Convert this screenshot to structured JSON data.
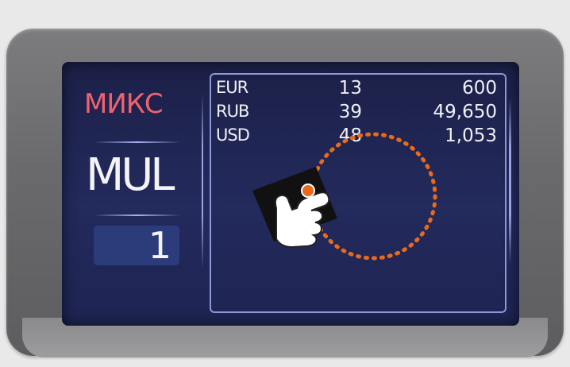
{
  "screen": {
    "mode_label": "МИКС",
    "mode_code": "MUL",
    "counter": "1"
  },
  "table": {
    "rows": [
      {
        "currency": "EUR",
        "count": "13",
        "amount": "600"
      },
      {
        "currency": "RUB",
        "count": "39",
        "amount": "49,650"
      },
      {
        "currency": "USD",
        "count": "48",
        "amount": "1,053"
      }
    ]
  },
  "overlay": {
    "gesture_icon": "hand-tap-icon",
    "tap_target_color": "#e86b1b"
  },
  "colors": {
    "screen_bg": "#232a5c",
    "mode_label": "#f0636e",
    "counter_box": "#2c3b7a"
  }
}
